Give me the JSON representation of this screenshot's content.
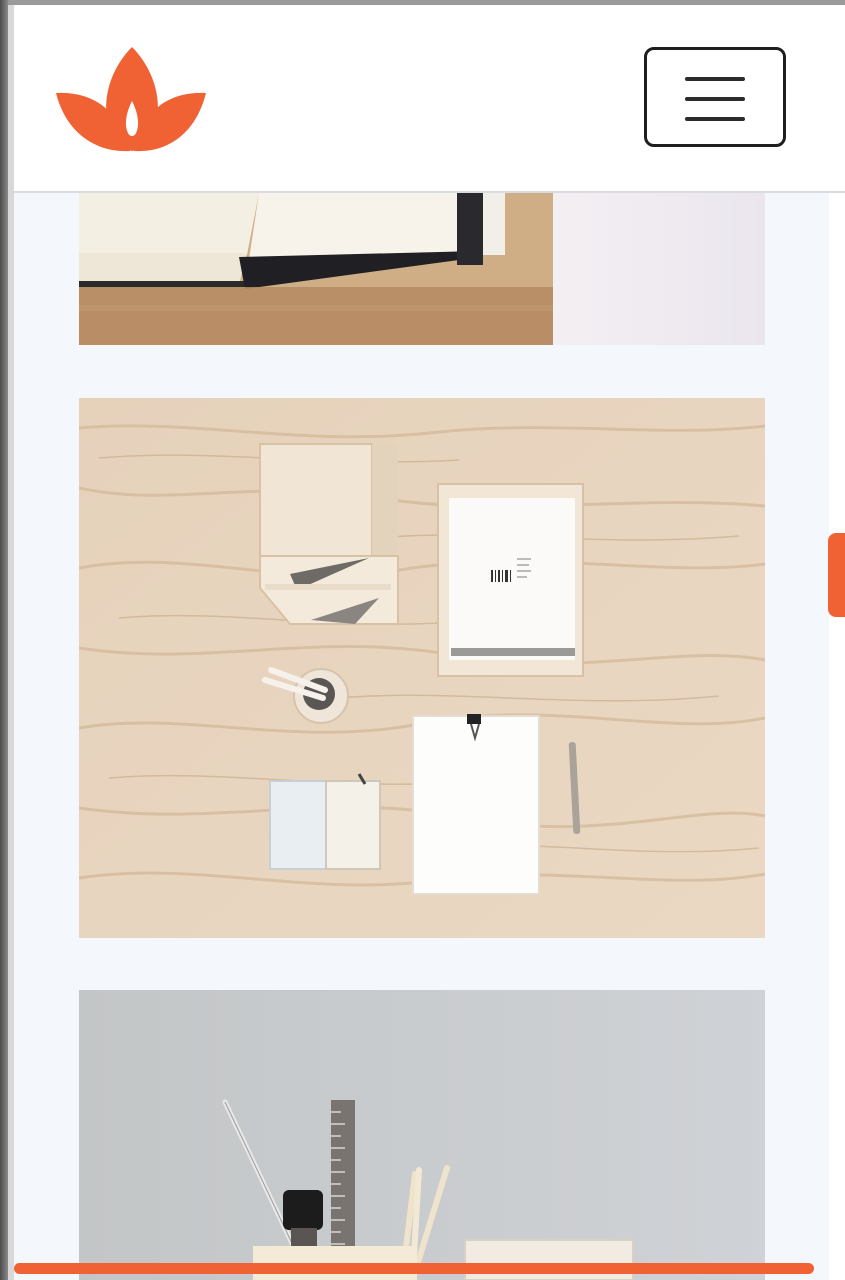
{
  "colors": {
    "accent": "#f06234",
    "page_background": "#f4f7fc",
    "header_background": "#ffffff"
  },
  "header": {
    "logo_icon": "lotus-logo-icon",
    "menu_icon": "hamburger-menu-icon"
  },
  "gallery": {
    "images": [
      {
        "description_icon": "open-notebook-on-desk-photo"
      },
      {
        "description_icon": "wooden-desk-organizers-flatlay-photo"
      },
      {
        "description_icon": "desk-supplies-on-grey-wall-photo"
      }
    ]
  },
  "scroll": {
    "vertical_position": 0.36,
    "horizontal_progress": 0.96
  }
}
